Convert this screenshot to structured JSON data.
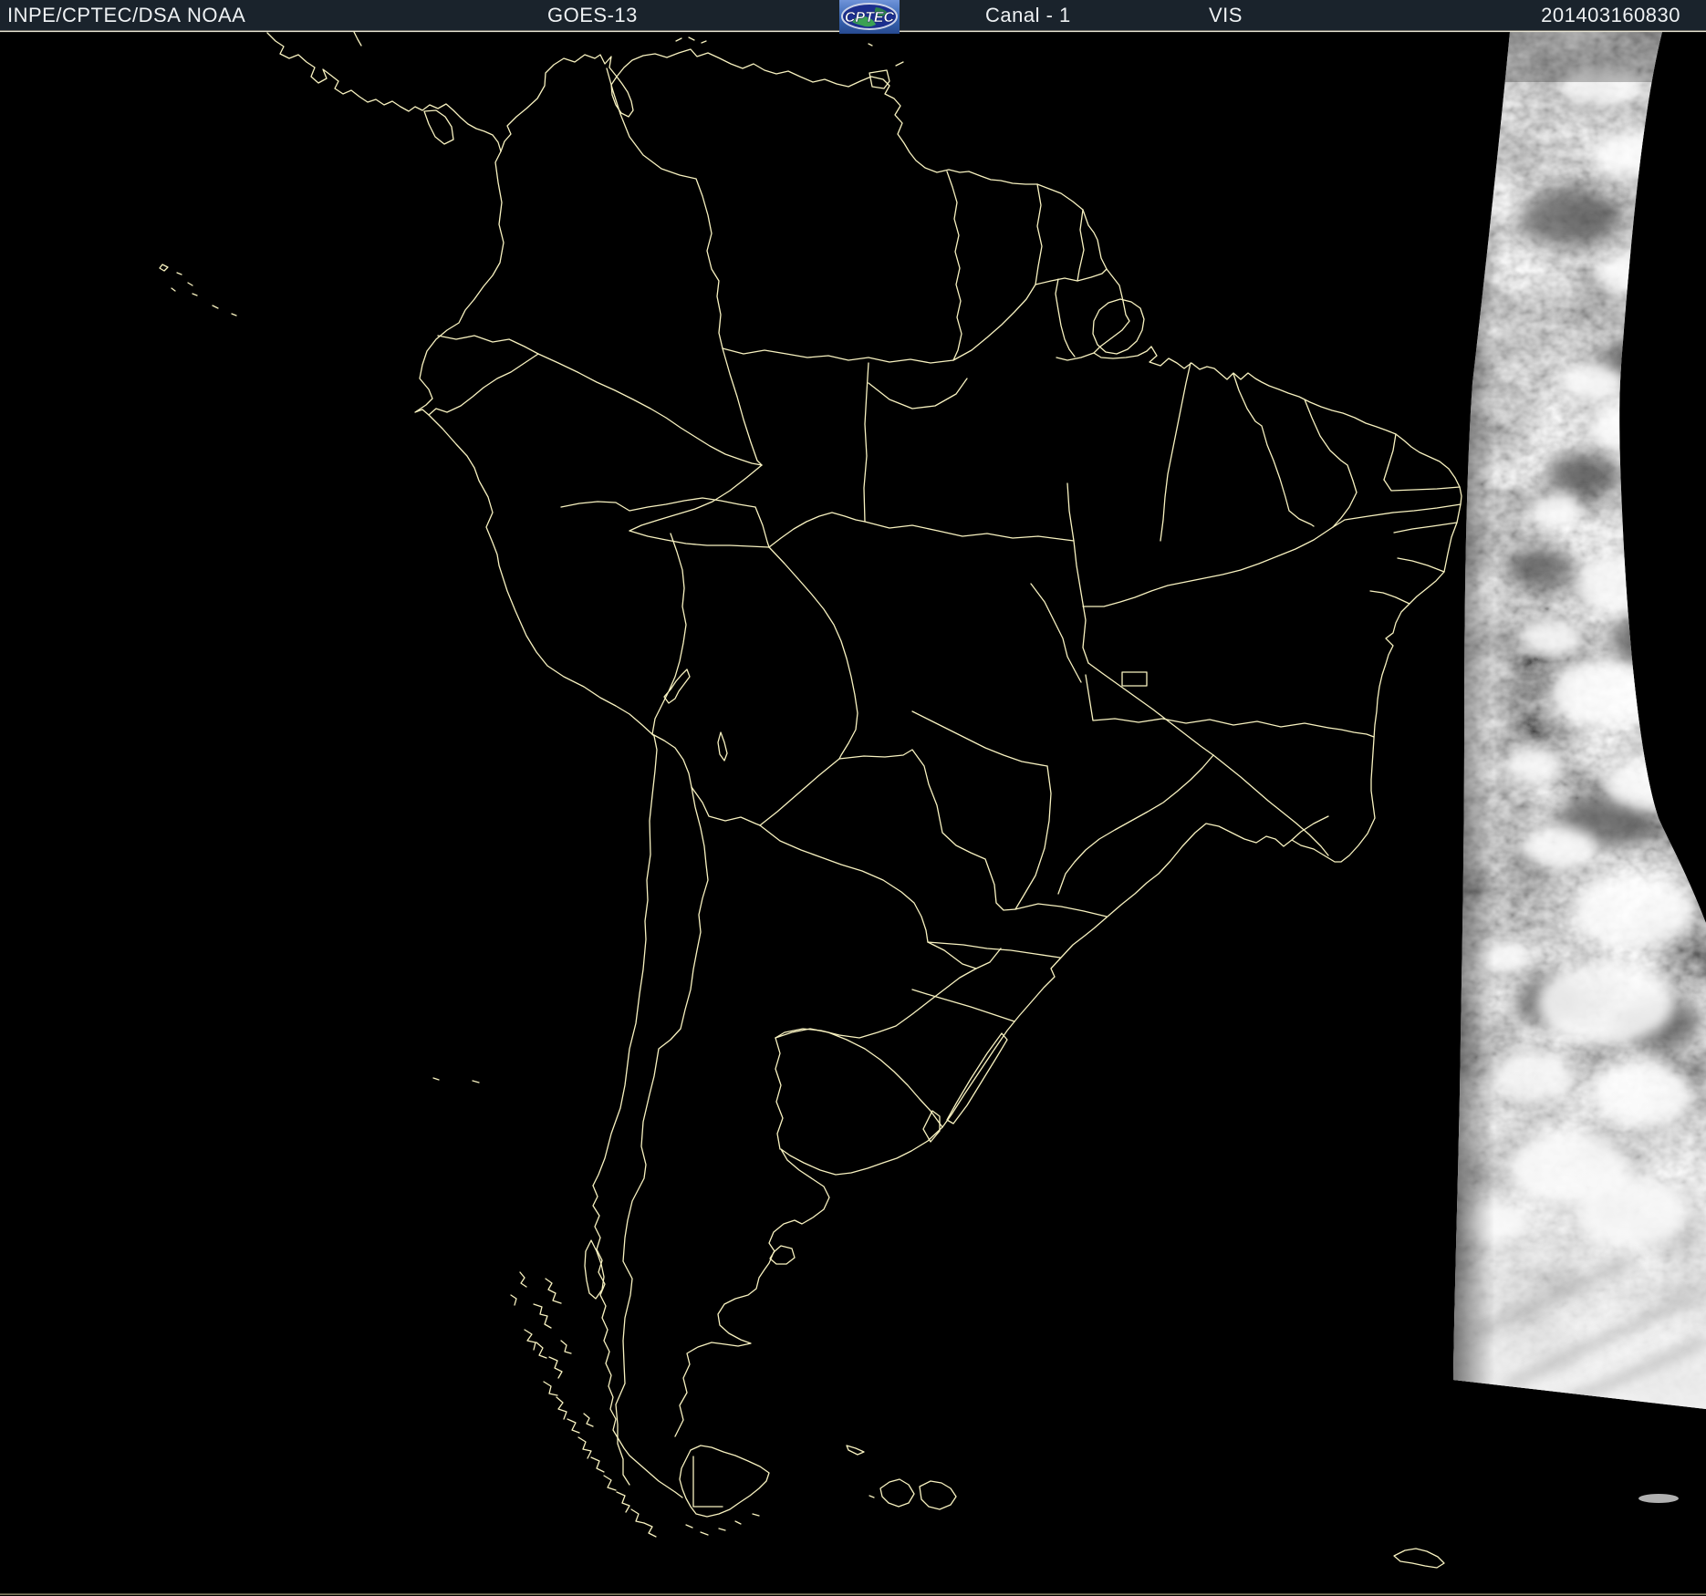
{
  "header": {
    "agency": "INPE/CPTEC/DSA",
    "noaa": "NOAA",
    "satellite": "GOES-13",
    "channel": "Canal - 1",
    "band": "VIS",
    "timestamp": "201403160830",
    "logo_text": "CPTEC"
  },
  "colors": {
    "header_bg": "#1a232c",
    "header_text": "#eef1f3",
    "map_bg": "#000000",
    "border_line": "#f8f2c0",
    "frame_line": "#e8e5d4",
    "logo_blue": "#3b68b6",
    "logo_ellipse": "#1c2f8e",
    "logo_green": "#3fae4c"
  },
  "map": {
    "region": "South America",
    "overlay": "country and Brazilian state borders",
    "daylight_swath": "sunlit cloud band along eastern limb"
  }
}
